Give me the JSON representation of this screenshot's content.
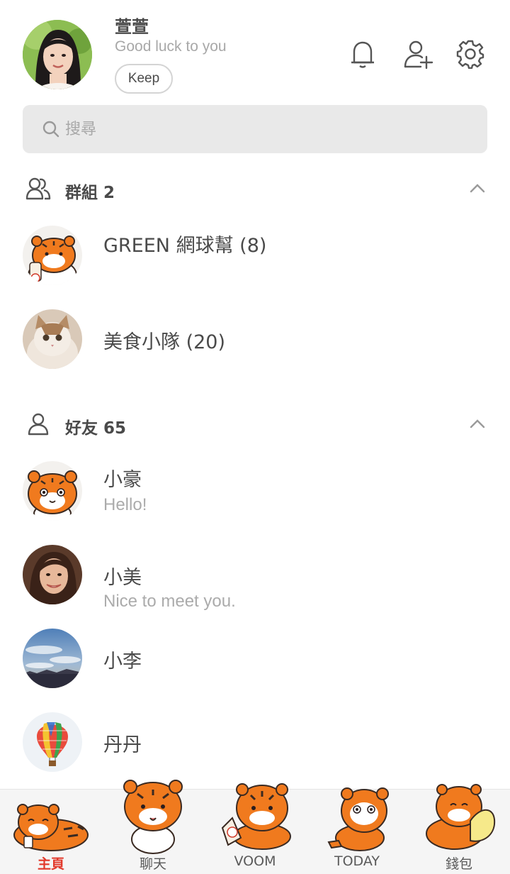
{
  "profile": {
    "name": "萱萱",
    "status": "Good luck to you",
    "keep_label": "Keep"
  },
  "header_icons": [
    "bell-icon",
    "add-friend-icon",
    "settings-icon"
  ],
  "search": {
    "placeholder": "搜尋"
  },
  "groups": {
    "title": "群組 2",
    "items": [
      {
        "name": "GREEN 網球幫 (8)",
        "avatar": "tiger-sticker"
      },
      {
        "name": "美食小隊 (20)",
        "avatar": "cat-photo"
      }
    ]
  },
  "friends": {
    "title": "好友 65",
    "items": [
      {
        "name": "小豪",
        "status": "Hello!",
        "avatar": "tiger-sticker"
      },
      {
        "name": "小美",
        "status": "Nice to meet you.",
        "avatar": "woman-photo"
      },
      {
        "name": "小李",
        "status": "",
        "avatar": "sky-photo"
      },
      {
        "name": "丹丹",
        "status": "",
        "avatar": "balloon-photo"
      }
    ]
  },
  "nav": {
    "tabs": [
      {
        "label": "主頁",
        "active": true
      },
      {
        "label": "聊天",
        "active": false
      },
      {
        "label": "VOOM",
        "active": false
      },
      {
        "label": "TODAY",
        "active": false
      },
      {
        "label": "錢包",
        "active": false
      }
    ]
  },
  "colors": {
    "accent_active": "#e2382a",
    "tiger_orange": "#f07a1e",
    "search_bg": "#e9e9e9",
    "subtle_text": "#ababab"
  }
}
